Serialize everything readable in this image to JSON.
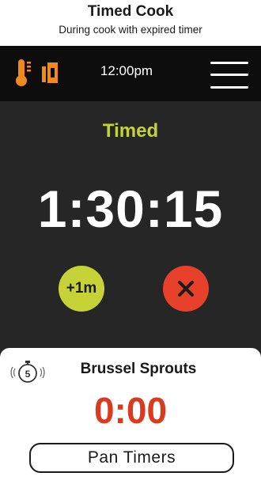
{
  "caption": {
    "title": "Timed Cook",
    "subtitle": "During cook with expired timer"
  },
  "status_bar": {
    "time": "12:00pm",
    "icons": [
      "thermometer-icon",
      "oven-door-icon",
      "hamburger-menu-icon"
    ]
  },
  "cook": {
    "mode_label": "Timed",
    "remaining_time": "1:30:15",
    "add_minute_label": "+1m",
    "cancel_icon": "close-icon"
  },
  "pan_timer": {
    "stopwatch_number": "5",
    "item_name": "Brussel Sprouts",
    "time": "0:00",
    "button_label": "Pan Timers"
  },
  "colors": {
    "accent_green": "#c6d336",
    "icon_orange": "#f08a1c",
    "alert_red": "#e8412b",
    "expired_text_red": "#d93a20",
    "screen_bg": "#262626",
    "topbar_bg": "#0d0d0d"
  }
}
